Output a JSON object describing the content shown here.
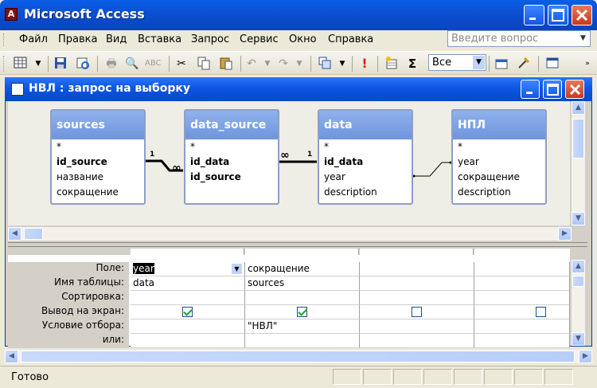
{
  "app": {
    "title": "Microsoft Access",
    "icon_letter": "A"
  },
  "menu": [
    "Файл",
    "Правка",
    "Вид",
    "Вставка",
    "Запрос",
    "Сервис",
    "Окно",
    "Справка"
  ],
  "ask": {
    "placeholder": "Введите вопрос"
  },
  "toolbar": {
    "combo_value": "Все",
    "icons": [
      "view-icon",
      "save-icon",
      "print-icon",
      "print-preview-icon",
      "spelling-icon",
      "cut-icon",
      "copy-icon",
      "paste-icon",
      "undo-icon",
      "redo-icon",
      "query-type-icon",
      "run-icon",
      "show-table-icon",
      "totals-icon",
      "properties-icon",
      "build-icon",
      "database-window-icon"
    ]
  },
  "query": {
    "title": "НВЛ : запрос на выборку"
  },
  "tables": [
    {
      "name": "sources",
      "fields": [
        {
          "name": "*",
          "key": false
        },
        {
          "name": "id_source",
          "key": true
        },
        {
          "name": "название",
          "key": false
        },
        {
          "name": "сокращение",
          "key": false
        }
      ]
    },
    {
      "name": "data_source",
      "fields": [
        {
          "name": "*",
          "key": false
        },
        {
          "name": "id_data",
          "key": true
        },
        {
          "name": "id_source",
          "key": true
        }
      ]
    },
    {
      "name": "data",
      "fields": [
        {
          "name": "*",
          "key": false
        },
        {
          "name": "id_data",
          "key": true
        },
        {
          "name": "year",
          "key": false
        },
        {
          "name": "description",
          "key": false
        }
      ]
    },
    {
      "name": "НПЛ",
      "fields": [
        {
          "name": "*",
          "key": false
        },
        {
          "name": "year",
          "key": false
        },
        {
          "name": "сокращение",
          "key": false
        },
        {
          "name": "description",
          "key": false
        }
      ]
    }
  ],
  "relations": [
    {
      "one": "1",
      "many": "∞"
    },
    {
      "one": "1",
      "many": "∞"
    }
  ],
  "grid": {
    "row_labels": [
      "Поле:",
      "Имя таблицы:",
      "Сортировка:",
      "Вывод на экран:",
      "Условие отбора:",
      "или:"
    ],
    "columns": [
      {
        "field": "year",
        "table": "data",
        "sort": "",
        "show": true,
        "criteria": "",
        "or": ""
      },
      {
        "field": "сокращение",
        "table": "sources",
        "sort": "",
        "show": true,
        "criteria": "\"НВЛ\"",
        "or": ""
      },
      {
        "field": "",
        "table": "",
        "sort": "",
        "show": false,
        "criteria": "",
        "or": ""
      },
      {
        "field": "",
        "table": "",
        "sort": "",
        "show": false,
        "criteria": "",
        "or": ""
      }
    ]
  },
  "status": {
    "text": "Готово"
  }
}
